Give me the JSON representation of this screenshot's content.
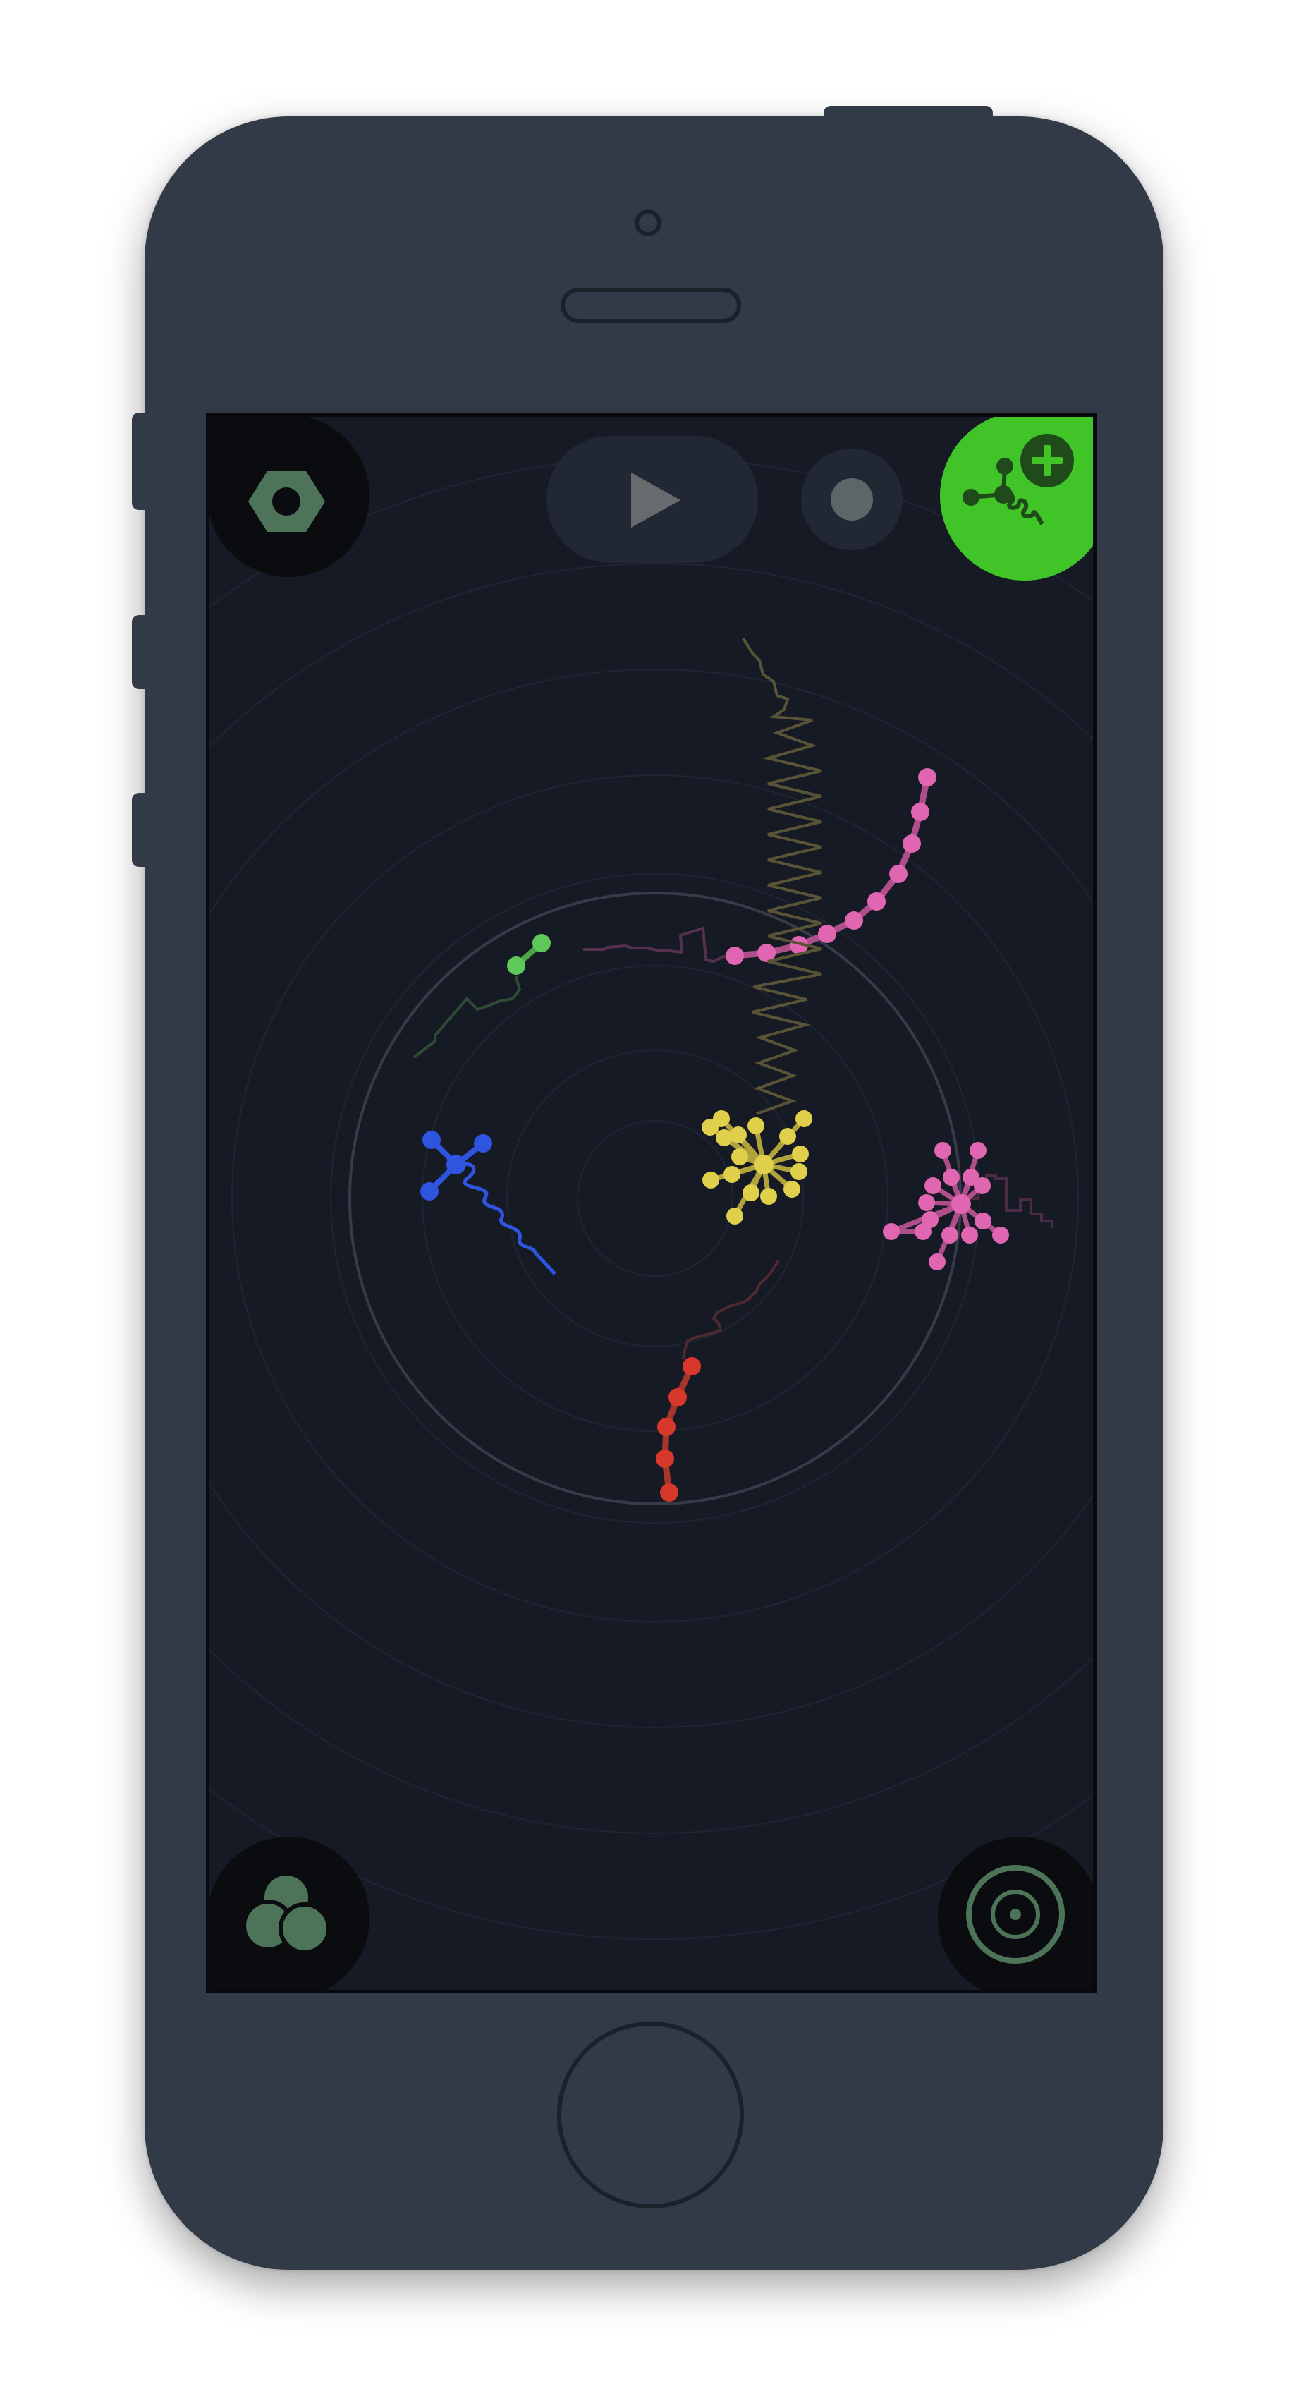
{
  "app": {
    "screen_bg": "#151a25",
    "accent_green": "#41c427",
    "icon_green": "#4d7358"
  },
  "toolbar": {
    "settings_icon": "hexagon-nut-icon",
    "play_icon": "play-triangle-icon",
    "record_icon": "dot-icon",
    "add_creature_icon": "add-creature-icon"
  },
  "bottom_bar": {
    "palette_icon": "three-circles-icon",
    "target_icon": "concentric-target-icon"
  },
  "creatures": [
    {
      "name": "green-chain",
      "color": "#5ec95a"
    },
    {
      "name": "pink-chain",
      "color": "#e066b2"
    },
    {
      "name": "blue-cross",
      "color": "#2f55e0"
    },
    {
      "name": "yellow-star",
      "color": "#e0cf4b"
    },
    {
      "name": "pink-star",
      "color": "#e066b2"
    },
    {
      "name": "red-chain",
      "color": "#d8382a"
    }
  ]
}
